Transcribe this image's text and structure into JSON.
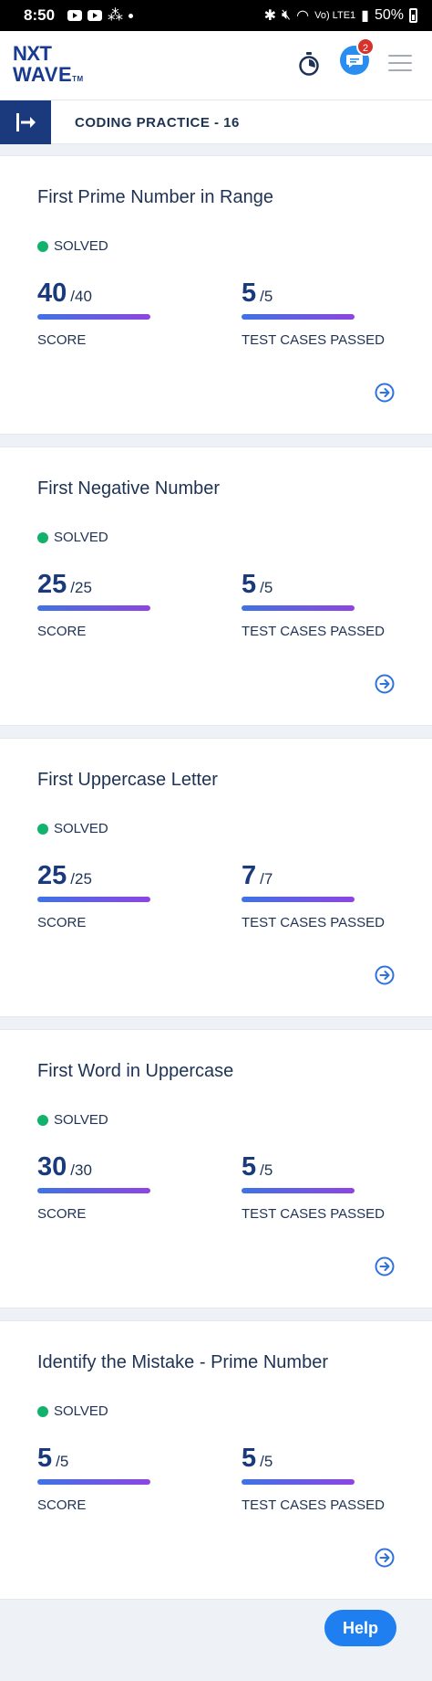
{
  "status_bar": {
    "time": "8:50",
    "signal": "Vo) LTE1",
    "battery": "50%"
  },
  "header": {
    "logo_top": "NXT",
    "logo_bottom": "WAVE",
    "logo_tm": "TM",
    "notification_count": "2"
  },
  "page": {
    "title": "CODING PRACTICE - 16"
  },
  "labels": {
    "score": "SCORE",
    "tests": "TEST CASES PASSED"
  },
  "questions": [
    {
      "title": "First Prime Number in Range",
      "status": "SOLVED",
      "score": "40",
      "score_total": "/40",
      "tests": "5",
      "tests_total": "/5"
    },
    {
      "title": "First Negative Number",
      "status": "SOLVED",
      "score": "25",
      "score_total": "/25",
      "tests": "5",
      "tests_total": "/5"
    },
    {
      "title": "First Uppercase Letter",
      "status": "SOLVED",
      "score": "25",
      "score_total": "/25",
      "tests": "7",
      "tests_total": "/7"
    },
    {
      "title": "First Word in Uppercase",
      "status": "SOLVED",
      "score": "30",
      "score_total": "/30",
      "tests": "5",
      "tests_total": "/5"
    },
    {
      "title": "Identify the Mistake - Prime Number",
      "status": "SOLVED",
      "score": "5",
      "score_total": "/5",
      "tests": "5",
      "tests_total": "/5"
    }
  ],
  "help_button": {
    "label": "Help"
  },
  "colors": {
    "brand": "#1a3a7d",
    "accent": "#1f7ff0",
    "solved": "#11b26b",
    "badge": "#d6312b"
  }
}
